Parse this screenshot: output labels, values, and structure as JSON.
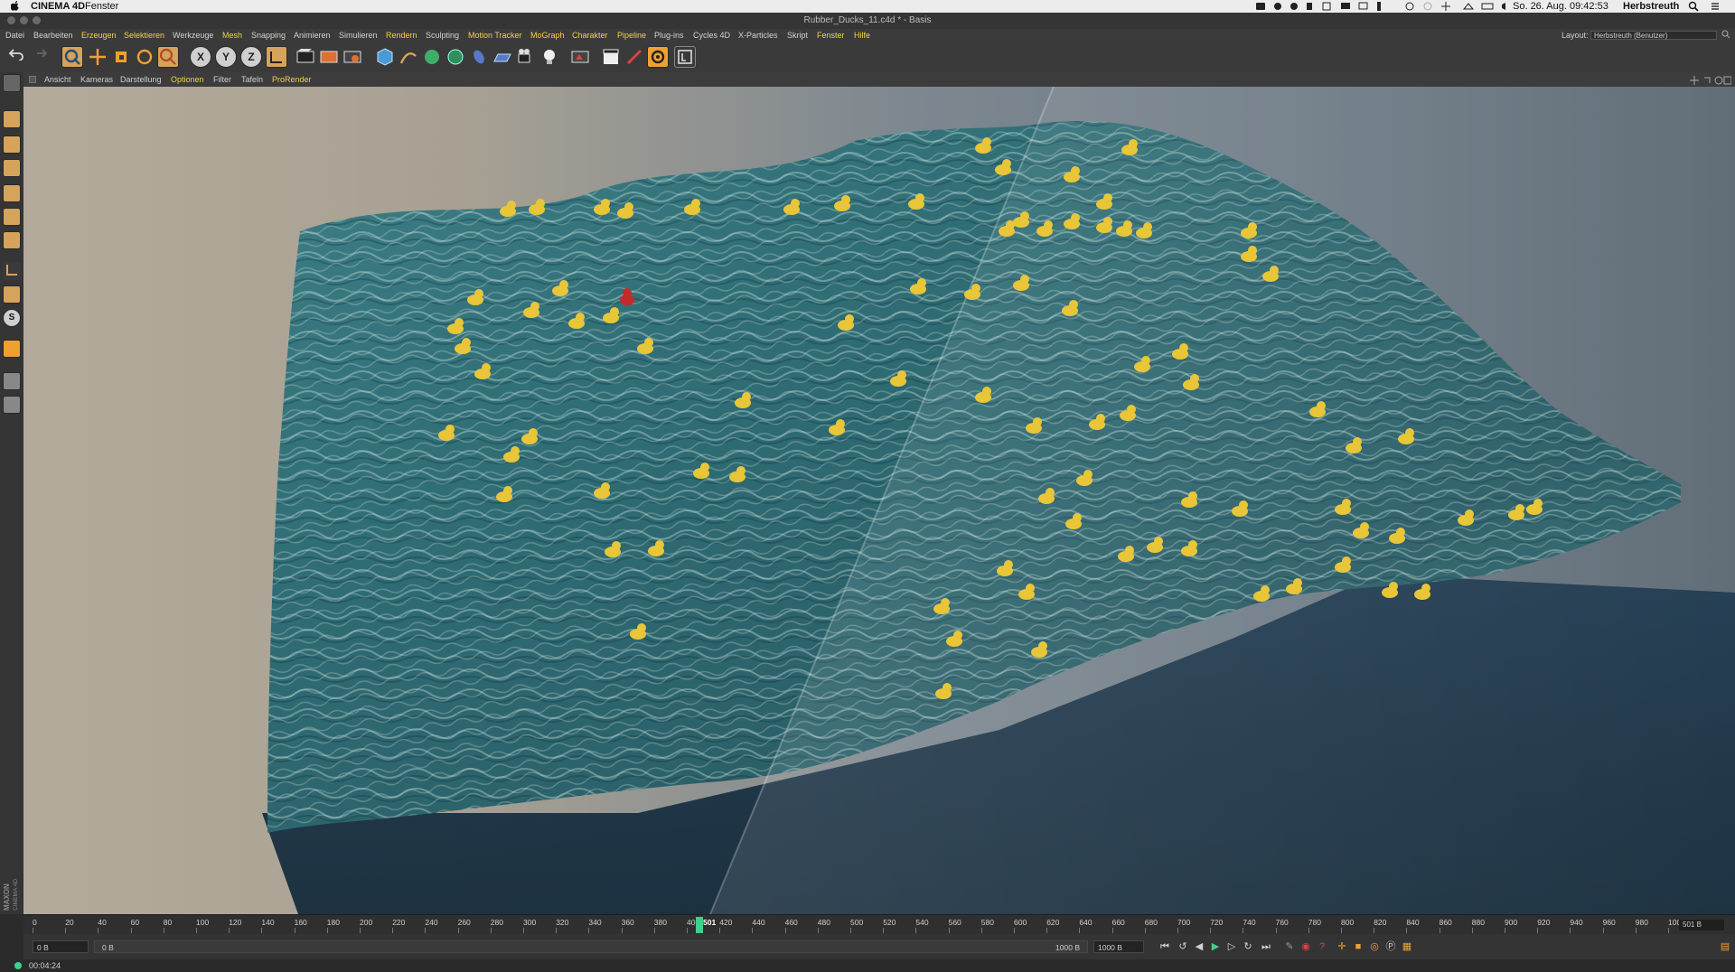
{
  "mac_menubar": {
    "apple": "",
    "app": "CINEMA 4D",
    "menu": "Fenster",
    "clock": "So. 26. Aug.  09:42:53",
    "user": "Herbstreuth"
  },
  "window": {
    "title": "Rubber_Ducks_11.c4d * - Basis"
  },
  "app_menu": {
    "items": [
      {
        "label": "Datei",
        "hl": false
      },
      {
        "label": "Bearbeiten",
        "hl": false
      },
      {
        "label": "Erzeugen",
        "hl": true
      },
      {
        "label": "Selektieren",
        "hl": true
      },
      {
        "label": "Werkzeuge",
        "hl": false
      },
      {
        "label": "Mesh",
        "hl": true
      },
      {
        "label": "Snapping",
        "hl": false
      },
      {
        "label": "Animieren",
        "hl": false
      },
      {
        "label": "Simulieren",
        "hl": false
      },
      {
        "label": "Rendern",
        "hl": true
      },
      {
        "label": "Sculpting",
        "hl": false
      },
      {
        "label": "Motion Tracker",
        "hl": true
      },
      {
        "label": "MoGraph",
        "hl": true
      },
      {
        "label": "Charakter",
        "hl": true
      },
      {
        "label": "Pipeline",
        "hl": true
      },
      {
        "label": "Plug-ins",
        "hl": false
      },
      {
        "label": "Cycles 4D",
        "hl": false
      },
      {
        "label": "X-Particles",
        "hl": false
      },
      {
        "label": "Skript",
        "hl": false
      },
      {
        "label": "Fenster",
        "hl": true
      },
      {
        "label": "Hilfe",
        "hl": true
      }
    ],
    "layout_label": "Layout:",
    "layout_value": "Herbstreuth (Benutzer)"
  },
  "toolbar": {
    "axis_x": "X",
    "axis_y": "Y",
    "axis_z": "Z"
  },
  "left_palette": {
    "s_label": "S",
    "brand": "MAXON CINEMA 4D"
  },
  "viewport_menu": {
    "items": [
      {
        "label": "Ansicht",
        "hl": false
      },
      {
        "label": "Kameras",
        "hl": false
      },
      {
        "label": "Darstellung",
        "hl": false
      },
      {
        "label": "Optionen",
        "hl": true
      },
      {
        "label": "Filter",
        "hl": false
      },
      {
        "label": "Tafeln",
        "hl": false
      },
      {
        "label": "ProRender",
        "hl": true
      }
    ]
  },
  "timeline": {
    "ticks": [
      "0",
      "20",
      "40",
      "60",
      "80",
      "100",
      "120",
      "140",
      "160",
      "180",
      "200",
      "220",
      "240",
      "260",
      "280",
      "300",
      "320",
      "340",
      "360",
      "380",
      "400",
      "420",
      "440",
      "460",
      "480",
      "500",
      "520",
      "540",
      "560",
      "580",
      "600",
      "620",
      "640",
      "660",
      "680",
      "700",
      "720",
      "740",
      "760",
      "780",
      "800",
      "820",
      "840",
      "860",
      "880",
      "900",
      "920",
      "940",
      "960",
      "980",
      "100"
    ],
    "current_frame": "501",
    "end_field": "501 B"
  },
  "transport": {
    "start_field": "0 B",
    "range_start": "0 B",
    "range_end": "1000 B",
    "end_field": "1000 B"
  },
  "status": {
    "time": "00:04:24"
  },
  "colors": {
    "accent": "#f1d44a",
    "playhead": "#3fcf8e",
    "duck": "#e8c638",
    "red_duck": "#c42a2a"
  }
}
